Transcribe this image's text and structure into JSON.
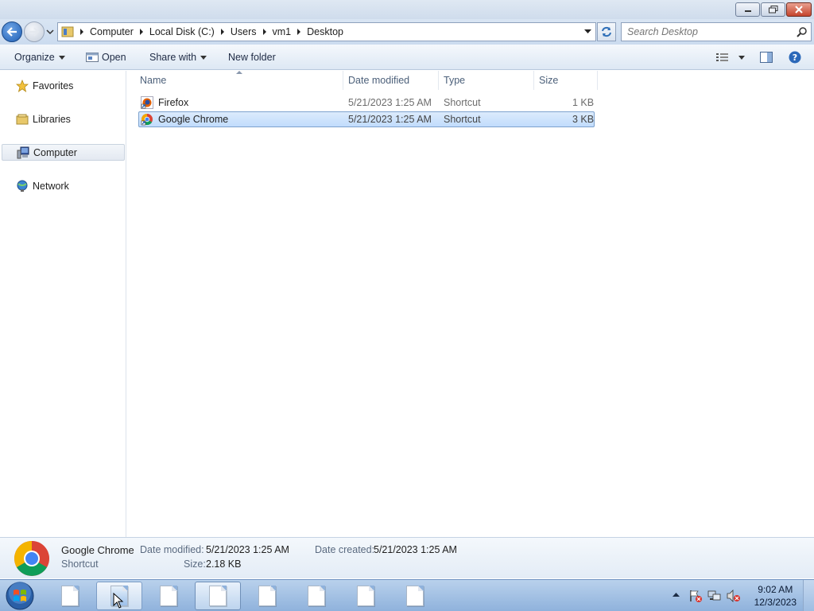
{
  "address": {
    "crumbs": [
      "Computer",
      "Local Disk (C:)",
      "Users",
      "vm1",
      "Desktop"
    ]
  },
  "search": {
    "placeholder": "Search Desktop"
  },
  "toolbar": {
    "organize": "Organize",
    "open": "Open",
    "share_with": "Share with",
    "new_folder": "New folder"
  },
  "nav": {
    "items": [
      {
        "label": "Favorites",
        "icon": "star-icon"
      },
      {
        "label": "Libraries",
        "icon": "libraries-icon"
      },
      {
        "label": "Computer",
        "icon": "computer-icon",
        "selected": true
      },
      {
        "label": "Network",
        "icon": "network-icon"
      }
    ]
  },
  "columns": [
    "Name",
    "Date modified",
    "Type",
    "Size"
  ],
  "files": [
    {
      "name": "Firefox",
      "date": "5/21/2023 1:25 AM",
      "type": "Shortcut",
      "size": "1 KB",
      "icon": "firefox-shortcut-icon"
    },
    {
      "name": "Google Chrome",
      "date": "5/21/2023 1:25 AM",
      "type": "Shortcut",
      "size": "3 KB",
      "icon": "chrome-shortcut-icon",
      "selected": true
    }
  ],
  "details": {
    "name": "Google Chrome",
    "kind": "Shortcut",
    "date_modified_label": "Date modified:",
    "date_modified": "5/21/2023 1:25 AM",
    "date_created_label": "Date created:",
    "date_created": "5/21/2023 1:25 AM",
    "size_label": "Size:",
    "size": "2.18 KB"
  },
  "taskbar": {
    "time": "9:02 AM",
    "date": "12/3/2023"
  },
  "colors": {
    "selection": "#c1dcfc",
    "accent": "#1f5fb5",
    "taskbar": "#8fb2dc"
  }
}
